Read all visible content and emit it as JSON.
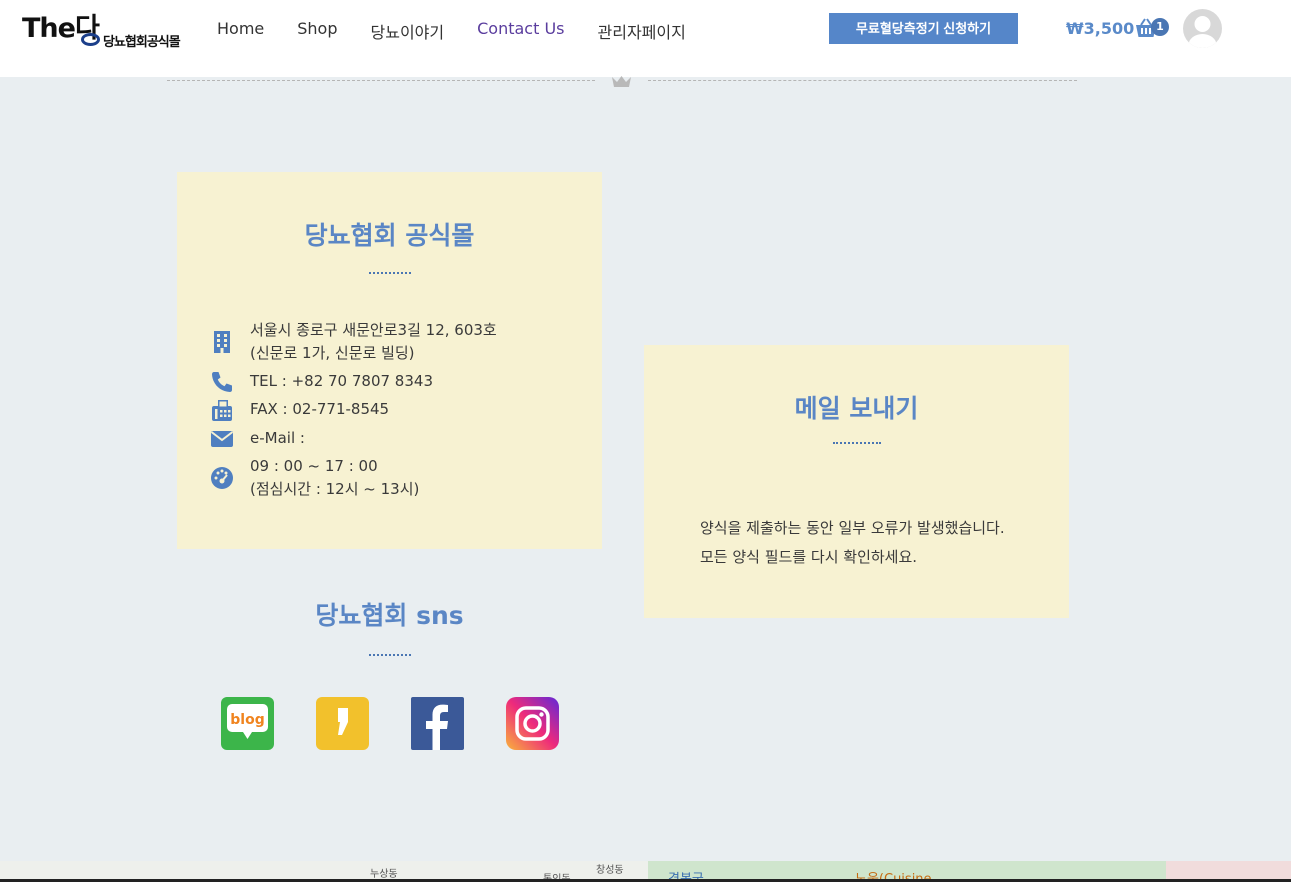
{
  "header": {
    "logo_main": "The다",
    "logo_sub": "당뇨협회공식몰",
    "nav": [
      "Home",
      "Shop",
      "당뇨이야기",
      "Contact Us",
      "관리자페이지"
    ],
    "active_nav": "Contact Us",
    "cta": "무료혈당측정기 신청하기",
    "cart_price": "₩3,500",
    "cart_count": "1"
  },
  "info": {
    "title": "당뇨협회 공식몰",
    "address_line1": "서울시 종로구 새문안로3길 12, 603호",
    "address_line2": "(신문로 1가, 신문로 빌딩)",
    "tel": "TEL : +82 70 7807 8343",
    "fax": "FAX :  02-771-8545",
    "email": "e-Mail :",
    "hours_line1": "09 : 00 ~ 17 : 00",
    "hours_line2": "(점심시간 : 12시 ~ 13시)"
  },
  "mail": {
    "title": "메일 보내기",
    "message": "양식을 제출하는 동안 일부 오류가 발생했습니다. 모든 양식 필드를 다시 확인하세요."
  },
  "sns": {
    "title": "당뇨협회 sns",
    "blog_label": "blog"
  },
  "map": {
    "labels": [
      "누상동",
      "통인동",
      "창성동",
      "경복궁",
      "노웅(Cuisine"
    ]
  },
  "colors": {
    "accent": "#5a86c5",
    "box_bg": "#f7f2d2",
    "page_bg": "#e9eef1",
    "cta_bg": "#5586c9",
    "nav_active": "#5a3d9e"
  }
}
